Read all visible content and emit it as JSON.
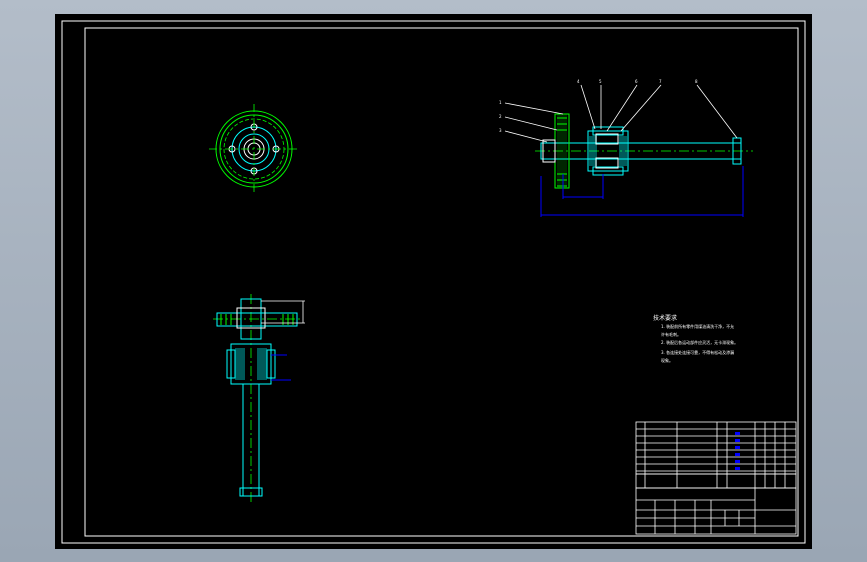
{
  "drawing": {
    "notes": {
      "heading": "技术要求",
      "lines": [
        "1. 装配前所有零件用煤油清洗干净，不允",
        "   许有毛刺。",
        "2. 装配后各运动部件应灵活，无卡滞现象。",
        "3. 各连接处连接可靠，不得有松动及渗漏",
        "   现象。"
      ]
    },
    "part_balloons": [
      "1",
      "2",
      "3",
      "4",
      "5",
      "6",
      "7",
      "8"
    ],
    "dimensions": {
      "bottom_length": "",
      "gap_length": ""
    },
    "title_block": {
      "drawing_title": "",
      "drawing_number": "",
      "scale": ""
    }
  },
  "colors": {
    "background": "#000000",
    "frame": "#ffffff",
    "part_outline": "#00ffff",
    "gear": "#00ff00",
    "dimension": "#0000ff",
    "centerline": "#00ff00"
  }
}
